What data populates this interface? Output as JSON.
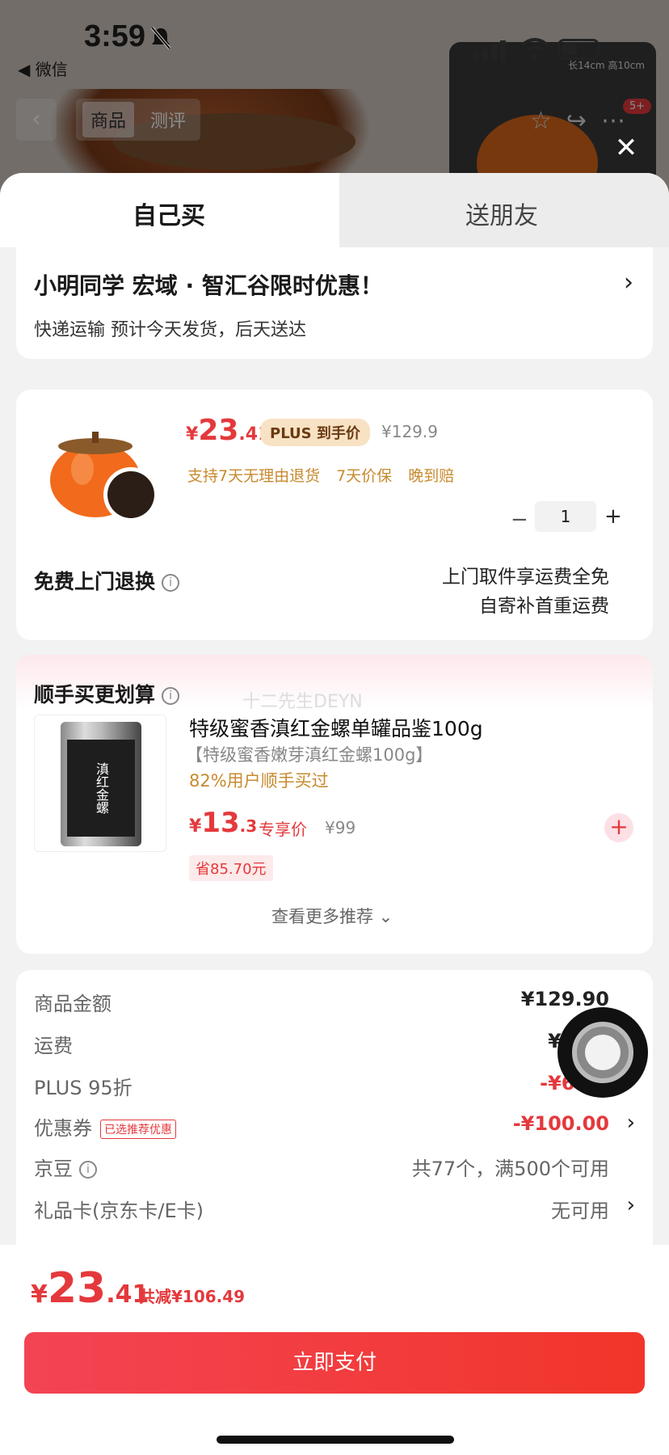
{
  "status_bar": {
    "time": "3:59",
    "back_app": "◀ 微信"
  },
  "background_page": {
    "tabs": [
      "商品",
      "测评"
    ],
    "mini_caption": "长14cm 高10cm",
    "badge": "5+"
  },
  "sheet": {
    "tabs": {
      "self_buy": "自己买",
      "gift": "送朋友"
    },
    "address": {
      "title": "小明同学  宏域 · 智汇谷限时优惠！",
      "delivery": "快递运输 预计今天发货，后天送达"
    },
    "product": {
      "price_symbol": "¥",
      "price_int": "23",
      "price_dec": ".41",
      "plus_tag": "PLUS 到手价",
      "original_price": "¥129.9",
      "services": [
        "支持7天无理由退货",
        "7天价保",
        "晚到赔"
      ],
      "quantity": "1",
      "qty_minus": "−",
      "qty_plus": "+",
      "return_title": "免费上门退换",
      "return_desc_1": "上门取件享运费全免",
      "return_desc_2": "自寄补首重运费"
    },
    "recommend": {
      "title": "顺手买更划算",
      "watermark": "十二先生DEYN",
      "can_label": "滇红金螺",
      "name": "特级蜜香滇红金螺单罐品鉴100g",
      "spec": "【特级蜜香嫩芽滇红金螺100g】",
      "percent": "82%用户顺手买过",
      "price_symbol": "¥",
      "price_int": "13",
      "price_dec": ".3",
      "exclusive": "专享价",
      "original_price": "¥99",
      "save": "省85.70元",
      "more": "查看更多推荐 ⌄"
    },
    "summary": {
      "goods_label": "商品金额",
      "goods_value": "¥129.90",
      "shipping_label": "运费",
      "shipping_value": "¥0.00",
      "plus_label": "PLUS 95折",
      "plus_value": "-¥6.49",
      "coupon_label": "优惠券",
      "coupon_tag": "已选推荐优惠",
      "coupon_value": "-¥100.00",
      "jingdou_label": "京豆",
      "jingdou_value": "共77个，满500个可用",
      "giftcard_label": "礼品卡(京东卡/E卡)",
      "giftcard_value": "无可用"
    }
  },
  "footer": {
    "total_symbol": "¥",
    "total_int": "23",
    "total_dec": ".41",
    "discount": "共减¥106.49",
    "pay_button": "立即支付"
  },
  "colors": {
    "accent": "#e4393c",
    "gold": "#c78a2e",
    "plus_bg": "#f8e2c4"
  },
  "icons": [
    "bell-muted-icon",
    "signal-icon",
    "wifi-icon",
    "battery-icon",
    "close-icon",
    "chevron-right-icon",
    "info-icon",
    "add-icon",
    "chevron-down-icon",
    "assistive-touch-icon"
  ]
}
